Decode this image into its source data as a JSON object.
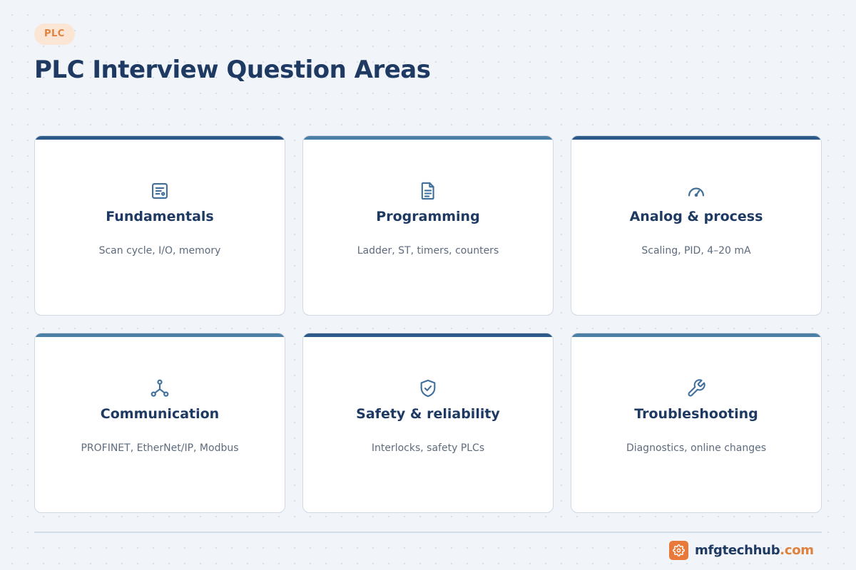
{
  "header": {
    "tag": "PLC",
    "title": "PLC Interview Question Areas"
  },
  "cards": [
    {
      "title": "Fundamentals",
      "desc": "Scan cycle, I/O, memory",
      "icon": "cpu-module-icon"
    },
    {
      "title": "Programming",
      "desc": "Ladder, ST, timers, counters",
      "icon": "document-icon"
    },
    {
      "title": "Analog & process",
      "desc": "Scaling, PID, 4–20 mA",
      "icon": "gauge-icon"
    },
    {
      "title": "Communication",
      "desc": "PROFINET, EtherNet/IP, Modbus",
      "icon": "network-icon"
    },
    {
      "title": "Safety & reliability",
      "desc": "Interlocks, safety PLCs",
      "icon": "shield-check-icon"
    },
    {
      "title": "Troubleshooting",
      "desc": "Diagnostics, online changes",
      "icon": "wrench-icon"
    }
  ],
  "footer": {
    "brand_name": "mfgtechhub",
    "brand_tld": ".com",
    "brand_icon": "gear-icon"
  },
  "colors": {
    "accent_orange": "#e8793a",
    "navy": "#1e3a63",
    "card_bar_dark": "#2d5a88",
    "card_bar_light": "#4b7fa6",
    "icon_blue": "#3f6f9a"
  }
}
